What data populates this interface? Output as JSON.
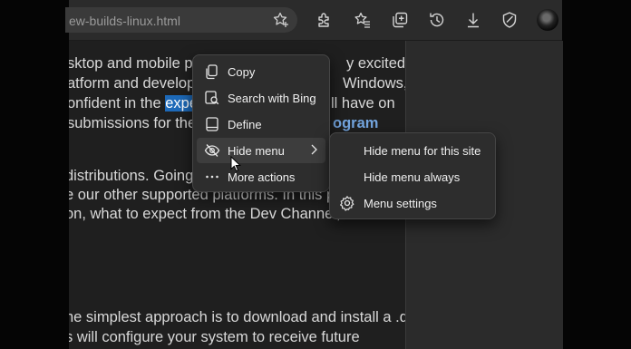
{
  "browser": {
    "address_text": "ew-builds-linux.html",
    "toolbar_icons": [
      "favorite-add-icon",
      "extensions-icon",
      "favorites-icon",
      "collections-icon",
      "history-icon",
      "downloads-icon",
      "browser-essentials-icon"
    ]
  },
  "article": {
    "lines": [
      {
        "pre": "sktop and mobile plat",
        "sel": "",
        "post": "",
        "tail": "y excited"
      },
      {
        "pre": "atform and develope",
        "sel": "",
        "post": "",
        "tail": "Windows,"
      },
      {
        "pre": "onfident in the ",
        "sel": "experi",
        "post": "",
        "tail": "ll have on"
      },
      {
        "pre": "submissions for the M",
        "sel": "",
        "post": "",
        "tail": "ogram"
      },
      {
        "pre": "distributions. Going fo",
        "sel": "",
        "post": "",
        "tail": ""
      },
      {
        "pre": "e our other supported platforms. In this post",
        "sel": "",
        "post": "",
        "tail": ""
      },
      {
        "pre": "on, what to expect from the Dev Channel, and",
        "sel": "",
        "post": "",
        "tail": ""
      },
      {
        "pre": "he simplest approach is to download and install a .deb",
        "sel": "",
        "post": "",
        "tail": ""
      },
      {
        "pre": "s will configure your system to receive future",
        "sel": "",
        "post": "",
        "tail": ""
      }
    ]
  },
  "context_menu": {
    "items": [
      {
        "label": "Copy",
        "icon": "copy-icon"
      },
      {
        "label": "Search with Bing",
        "icon": "search-with-bing-icon"
      },
      {
        "label": "Define",
        "icon": "define-icon"
      },
      {
        "label": "Hide menu",
        "icon": "hide-menu-icon"
      },
      {
        "label": "More actions",
        "icon": "more-actions-icon"
      }
    ]
  },
  "submenu": {
    "items": [
      {
        "label": "Hide menu for this site"
      },
      {
        "label": "Hide menu always"
      },
      {
        "label": "Menu settings",
        "icon": "settings-icon"
      }
    ]
  }
}
